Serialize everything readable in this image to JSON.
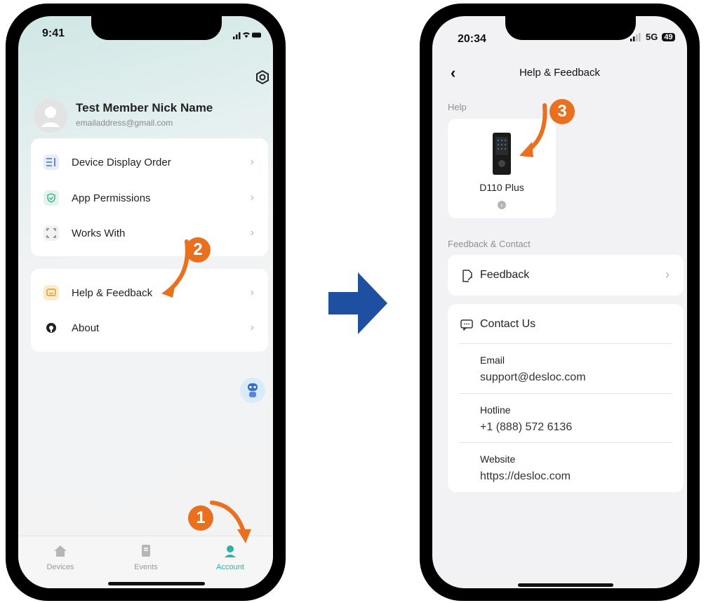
{
  "phone1": {
    "status": {
      "time": "9:41"
    },
    "profile": {
      "name": "Test Member Nick Name",
      "email": "emailaddress@gmail.com"
    },
    "menu_group_1": [
      {
        "label": "Device Display Order",
        "icon": "list-order-icon"
      },
      {
        "label": "App Permissions",
        "icon": "shield-check-icon"
      },
      {
        "label": "Works With",
        "icon": "connect-frame-icon"
      }
    ],
    "menu_group_2": [
      {
        "label": "Help & Feedback",
        "icon": "message-box-icon"
      },
      {
        "label": "About",
        "icon": "info-circle-icon"
      }
    ],
    "tabs": [
      {
        "label": "Devices",
        "icon": "home-icon"
      },
      {
        "label": "Events",
        "icon": "events-icon"
      },
      {
        "label": "Account",
        "icon": "account-icon",
        "active": true
      }
    ]
  },
  "phone2": {
    "status": {
      "time": "20:34",
      "network": "5G",
      "battery": "49"
    },
    "title": "Help & Feedback",
    "help_section_label": "Help",
    "device": {
      "name": "D110 Plus"
    },
    "feedback_section_label": "Feedback & Contact",
    "feedback_label": "Feedback",
    "contact_label": "Contact Us",
    "contacts": [
      {
        "key": "Email",
        "value": "support@desloc.com"
      },
      {
        "key": "Hotline",
        "value": "+1 (888) 572 6136"
      },
      {
        "key": "Website",
        "value": "https://desloc.com"
      }
    ]
  },
  "steps": [
    "1",
    "2",
    "3"
  ],
  "colors": {
    "accent": "#2bb3a3",
    "arrow": "#1f4fa0",
    "step": "#e8701f"
  }
}
